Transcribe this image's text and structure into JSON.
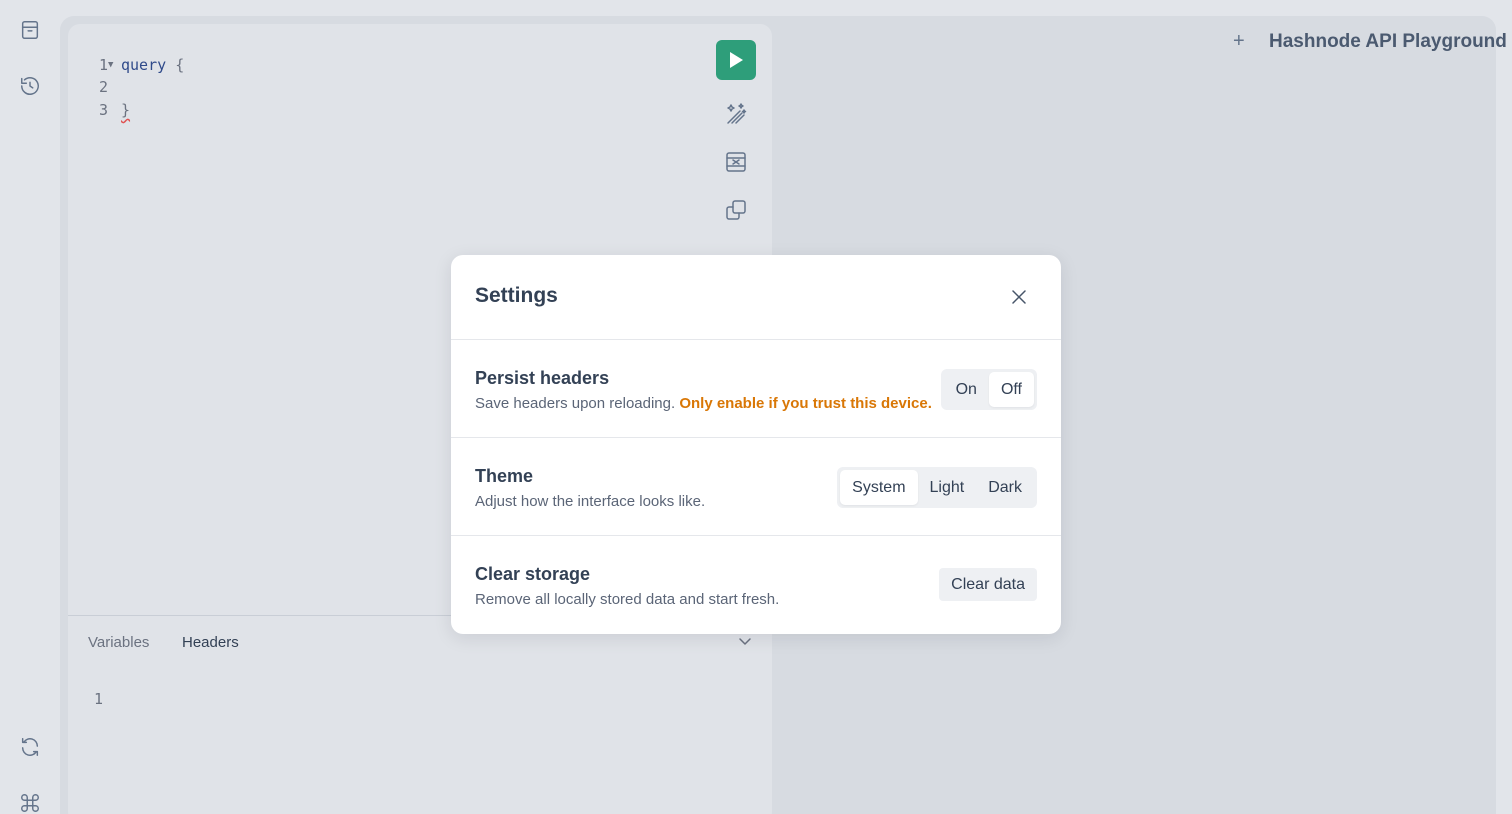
{
  "rail": {
    "icons": [
      "archive-icon",
      "history-icon",
      "refresh-icon",
      "command-icon"
    ]
  },
  "editor": {
    "lines": [
      {
        "number": "1",
        "code": "query",
        "brace": "{"
      },
      {
        "number": "2",
        "code": "",
        "brace": ""
      },
      {
        "number": "3",
        "code": "",
        "brace": "}"
      }
    ],
    "tools": [
      "prettify-icon",
      "merge-icon",
      "copy-icon"
    ]
  },
  "bottom_pane": {
    "tabs": [
      {
        "label": "Variables",
        "active": false
      },
      {
        "label": "Headers",
        "active": true
      }
    ],
    "line_number": "1"
  },
  "header": {
    "add_tab": "+",
    "title": "Hashnode API Playground"
  },
  "settings": {
    "title": "Settings",
    "persist_headers": {
      "title": "Persist headers",
      "description": "Save headers upon reloading.",
      "warning": "Only enable if you trust this device.",
      "options": [
        "On",
        "Off"
      ],
      "selected": "Off"
    },
    "theme": {
      "title": "Theme",
      "description": "Adjust how the interface looks like.",
      "options": [
        "System",
        "Light",
        "Dark"
      ],
      "selected": "System"
    },
    "clear_storage": {
      "title": "Clear storage",
      "description": "Remove all locally stored data and start fresh.",
      "button": "Clear data"
    }
  },
  "colors": {
    "run_button": "#2e9e7a",
    "warning": "#d97706"
  }
}
